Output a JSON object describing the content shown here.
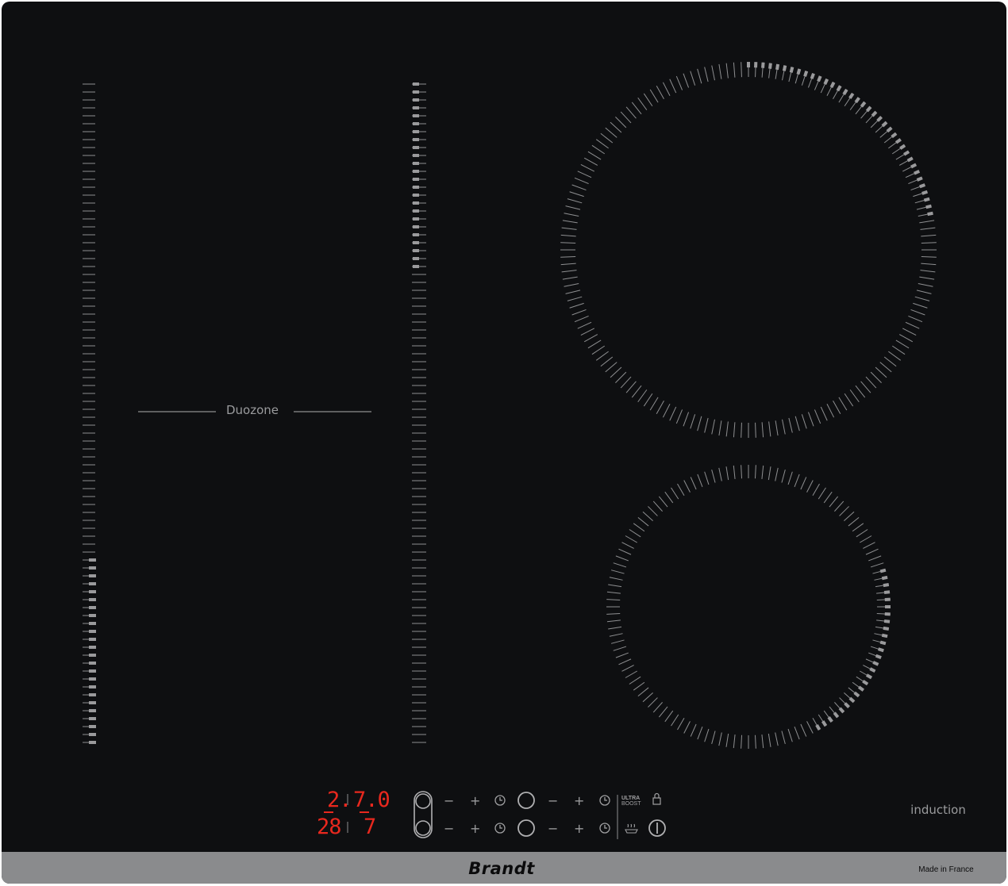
{
  "product": {
    "zone_label": "Duozone",
    "technology_label": "induction",
    "brand": "Brandt",
    "origin": "Made in France"
  },
  "display": {
    "top_left": "2.",
    "top_right": "7.0",
    "bottom_left": "28",
    "bottom_right": "7"
  },
  "controls": {
    "minus": "−",
    "plus": "+",
    "ultra_boost_line1": "ULTRA",
    "ultra_boost_line2": "BOOST"
  },
  "icons": [
    "slider-pill-icon",
    "timer-icon",
    "zone-select-ring-icon",
    "lock-icon",
    "keep-warm-icon",
    "power-icon"
  ],
  "colors": {
    "glass": "#0e0f11",
    "tick": "#8e8f91",
    "tick_lit": "#9a9a9c",
    "display_red": "#e8281e",
    "bar": "#8a8b8d"
  }
}
